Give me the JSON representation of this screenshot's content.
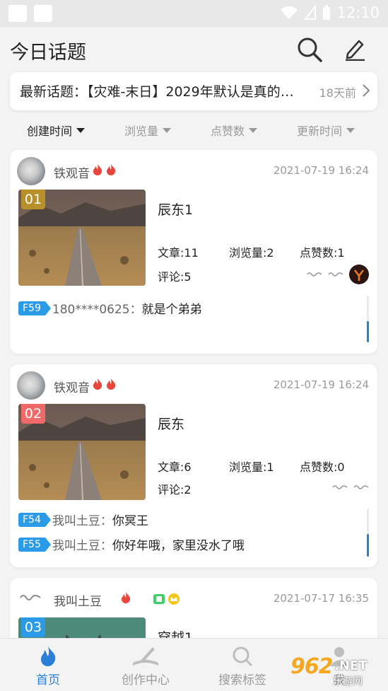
{
  "status_bar": {
    "time": "12:10"
  },
  "header": {
    "title": "今日话题"
  },
  "latest": {
    "text": "最新话题：【灾难-末日】2029年默认是真的…",
    "time": "18天前"
  },
  "sort": {
    "items": [
      {
        "label": "创建时间",
        "active": true
      },
      {
        "label": "浏览量",
        "active": false
      },
      {
        "label": "点赞数",
        "active": false
      },
      {
        "label": "更新时间",
        "active": false
      }
    ]
  },
  "cards": [
    {
      "author": "铁观音",
      "date": "2021-07-19 16:24",
      "rank": "01",
      "name": "辰东1",
      "articles": "文章:11",
      "views": "浏览量:2",
      "likes": "点赞数:1",
      "comments": "评论:5",
      "replies": [
        {
          "floor": "F59",
          "user": "180****0625：",
          "text": "就是个弟弟"
        }
      ]
    },
    {
      "author": "铁观音",
      "date": "2021-07-19 16:24",
      "rank": "02",
      "name": "辰东",
      "articles": "文章:6",
      "views": "浏览量:1",
      "likes": "点赞数:0",
      "comments": "评论:2",
      "replies": [
        {
          "floor": "F54",
          "user": "我叫土豆：",
          "text": "你冥王"
        },
        {
          "floor": "F55",
          "user": "我叫土豆：",
          "text": "你好年哦，家里没水了哦"
        }
      ]
    },
    {
      "author": "我叫土豆",
      "date": "2021-07-17 16:35",
      "rank": "03",
      "name": "穿越1"
    }
  ],
  "tabs": [
    {
      "label": "首页",
      "icon": "flame-icon",
      "active": true
    },
    {
      "label": "创作中心",
      "icon": "quill-book-icon",
      "active": false
    },
    {
      "label": "搜索标签",
      "icon": "search-icon",
      "active": false
    },
    {
      "label": "我",
      "icon": "user-icon",
      "active": false
    }
  ],
  "watermark": {
    "number": "962",
    "suffix": ".NET",
    "site": "乐游网"
  },
  "colors": {
    "accent": "#2b7fd8",
    "flame": "#e8463c",
    "rank1": "#b8902b",
    "rank2": "#f06a6a",
    "rank3": "#2b9be8"
  }
}
